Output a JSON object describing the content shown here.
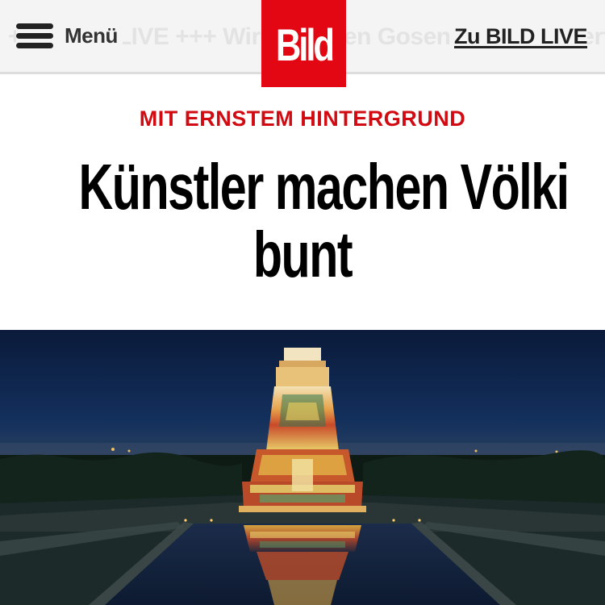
{
  "header": {
    "menu_label": "Menü",
    "ticker_text": "+++ BILD LIVE +++ Wir sprechen Gosens und Schwertz +++ Die Bundesliga heute +++",
    "live_link_label": "Zu BILD LIVE"
  },
  "logo": {
    "text": "Bild",
    "color": "#e30613"
  },
  "article": {
    "kicker": "MIT ERNSTEM HINTERGRUND",
    "headline_line1": "Künstler machen Völki",
    "headline_line2": "bunt"
  },
  "colors": {
    "accent_red": "#d20a11",
    "header_bg": "#f4f4f4",
    "night_sky": "#0d1f40"
  }
}
